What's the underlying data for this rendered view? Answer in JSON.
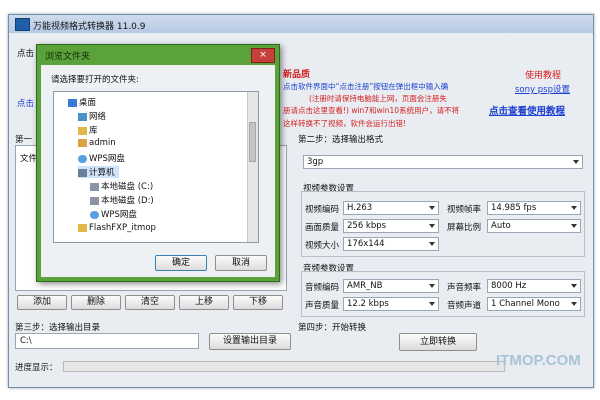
{
  "app": {
    "title": "万能视频格式转换器 11.0.9"
  },
  "promo": {
    "left_click": "点击",
    "left_click2": "点击",
    "new_product": "新品质",
    "line1": "点击软件界面中“点击注册”按钮在弹出框中输入确",
    "line2": "(注册时请保持电脑能上网，页面会注册失",
    "line3": "册请点击这里查看!) win7和win10系统用户，请不将",
    "line4": "这样转换不了视频，软件会运行出错!",
    "tutorial": "使用教程",
    "setup_link": "sony psp设置",
    "view_tutorial": "点击查看使用教程"
  },
  "step1": {
    "label": "第一",
    "col_file": "文件",
    "buttons": [
      "添加",
      "删除",
      "清空",
      "上移",
      "下移"
    ]
  },
  "step2": {
    "label": "第二步：选择输出格式",
    "format": "3gp",
    "video_group": "视频参数设置",
    "video_codec_label": "视频编码",
    "video_codec": "H.263",
    "video_quality_label": "画面质量",
    "video_quality": "256 kbps",
    "video_size_label": "视频大小",
    "video_size": "176x144",
    "frame_rate_label": "视频帧率",
    "frame_rate": "14.985 fps",
    "aspect_label": "屏幕比例",
    "aspect": "Auto",
    "audio_group": "音频参数设置",
    "audio_codec_label": "音频编码",
    "audio_codec": "AMR_NB",
    "audio_quality_label": "声音质量",
    "audio_quality": "12.2 kbps",
    "sample_rate_label": "声音频率",
    "sample_rate": "8000 Hz",
    "channels_label": "音频声道",
    "channels": "1 Channel Mono"
  },
  "step3": {
    "label": "第三步：选择输出目录",
    "path": "C:\\",
    "set_dir_button": "设置输出目录"
  },
  "step4": {
    "label": "第四步：开始转换",
    "convert_button": "立即转换"
  },
  "progress": {
    "label": "进度显示："
  },
  "dialog": {
    "title": "浏览文件夹",
    "prompt": "请选择要打开的文件夹:",
    "tree": [
      "桌面",
      "网络",
      "库",
      "admin",
      "WPS网盘",
      "计算机",
      "本地磁盘 (C:)",
      "本地磁盘 (D:)",
      "WPS网盘",
      "FlashFXP_itmop"
    ],
    "ok": "确定",
    "cancel": "取消",
    "close_glyph": "×"
  },
  "watermark": "ITMOP.COM",
  "colors": {
    "promo_red": "#d42020",
    "link_blue": "#1a3fd0",
    "dialog_frame": "#5ca23a"
  }
}
